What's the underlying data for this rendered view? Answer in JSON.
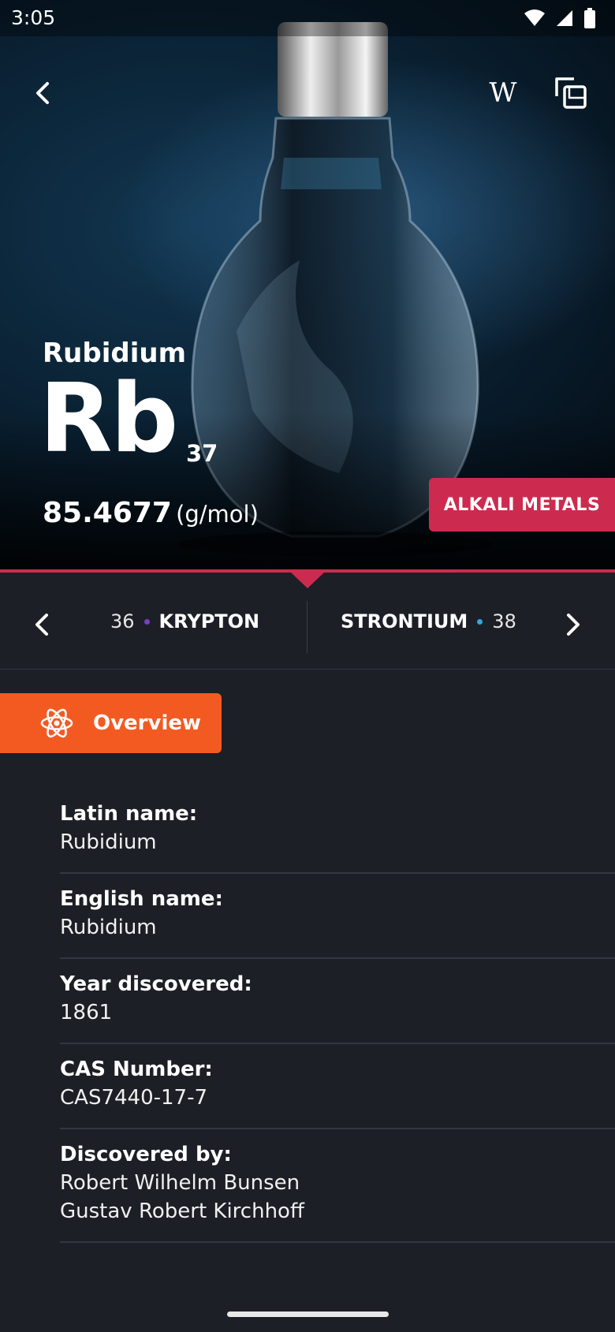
{
  "status_bar": {
    "time": "3:05"
  },
  "header": {
    "back_icon": "chevron-left-icon",
    "wiki_label": "W",
    "compare_icon": "compare-icon"
  },
  "element": {
    "name": "Rubidium",
    "symbol": "Rb",
    "atomic_number": "37",
    "mass_value": "85.4677",
    "mass_unit": "(g/mol)",
    "category": "ALKALI METALS",
    "category_color": "#cc2b4f"
  },
  "navigation": {
    "previous": {
      "number": "36",
      "name": "KRYPTON",
      "dot_color": "#7b3fbf"
    },
    "next": {
      "name": "STRONTIUM",
      "number": "38",
      "dot_color": "#2fa7e0"
    }
  },
  "tab": {
    "label": "Overview",
    "icon": "atom-icon",
    "color": "#f35a22"
  },
  "details": [
    {
      "label": "Latin name:",
      "value": "Rubidium"
    },
    {
      "label": "English name:",
      "value": "Rubidium"
    },
    {
      "label": "Year discovered:",
      "value": "1861"
    },
    {
      "label": "CAS Number:",
      "value": "CAS7440-17-7"
    },
    {
      "label": "Discovered by:",
      "value": "Robert Wilhelm Bunsen",
      "value2": "Gustav Robert Kirchhoff"
    }
  ]
}
